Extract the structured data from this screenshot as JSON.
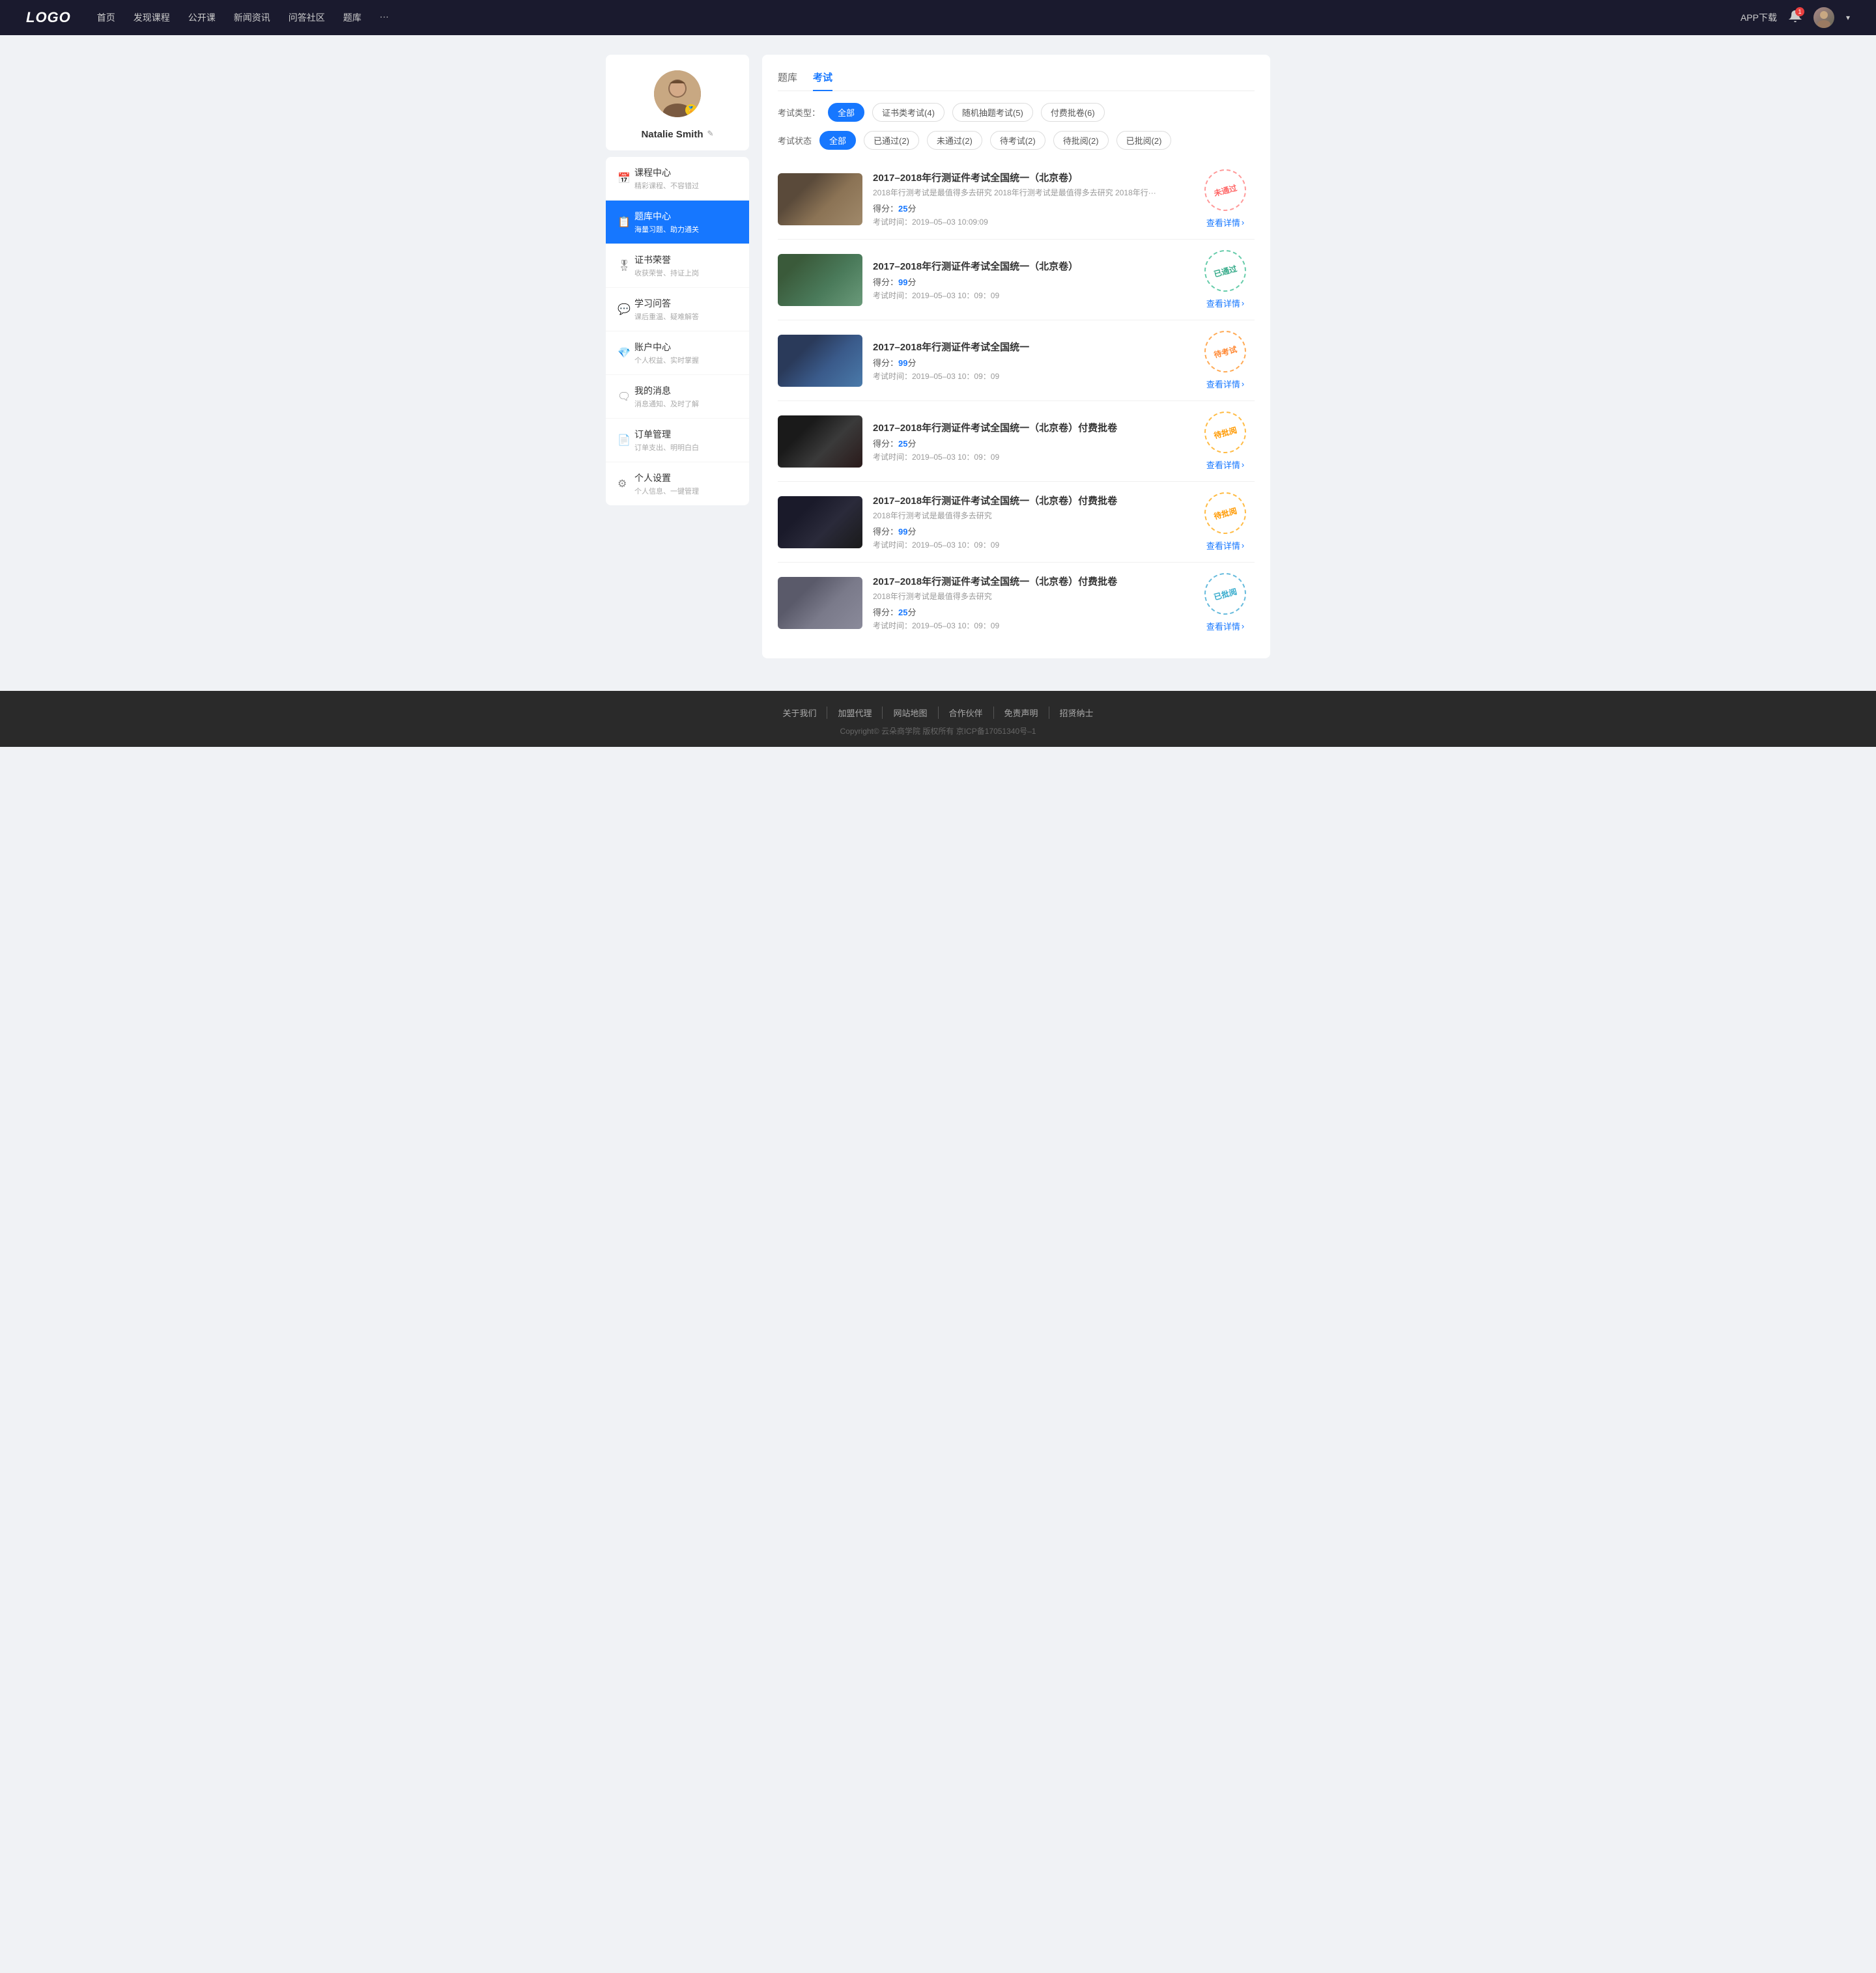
{
  "navbar": {
    "logo": "LOGO",
    "links": [
      "首页",
      "发现课程",
      "公开课",
      "新闻资讯",
      "问答社区",
      "题库",
      "···"
    ],
    "app_download": "APP下载",
    "more_icon": "···"
  },
  "sidebar": {
    "profile": {
      "name": "Natalie Smith",
      "edit_icon": "✎",
      "badge_icon": "🏅"
    },
    "items": [
      {
        "id": "course",
        "icon": "📅",
        "label": "课程中心",
        "sub": "精彩课程、不容错过"
      },
      {
        "id": "question",
        "icon": "📋",
        "label": "题库中心",
        "sub": "海量习题、助力通关"
      },
      {
        "id": "cert",
        "icon": "🎖",
        "label": "证书荣誉",
        "sub": "收获荣誉、持证上岗"
      },
      {
        "id": "qa",
        "icon": "💬",
        "label": "学习问答",
        "sub": "课后重温、疑难解答"
      },
      {
        "id": "account",
        "icon": "💎",
        "label": "账户中心",
        "sub": "个人权益、实时掌握"
      },
      {
        "id": "message",
        "icon": "🗨",
        "label": "我的消息",
        "sub": "消息通知、及时了解"
      },
      {
        "id": "order",
        "icon": "📄",
        "label": "订单管理",
        "sub": "订单支出、明明白白"
      },
      {
        "id": "settings",
        "icon": "⚙",
        "label": "个人设置",
        "sub": "个人信息、一键管理"
      }
    ]
  },
  "content": {
    "tabs": [
      "题库",
      "考试"
    ],
    "active_tab": "考试",
    "type_filter": {
      "label": "考试类型：",
      "options": [
        "全部",
        "证书类考试(4)",
        "随机抽题考试(5)",
        "付费批卷(6)"
      ],
      "active": "全部"
    },
    "status_filter": {
      "label": "考试状态",
      "options": [
        "全部",
        "已通过(2)",
        "未通过(2)",
        "待考试(2)",
        "待批阅(2)",
        "已批阅(2)"
      ],
      "active": "全部"
    },
    "exams": [
      {
        "id": 1,
        "thumb_class": "thumb-1",
        "title": "2017–2018年行测证件考试全国统一（北京卷）",
        "desc": "2018年行测考试是最值得多去研究 2018年行测考试是最值得多去研究 2018年行···",
        "score_label": "得分：",
        "score": "25",
        "score_unit": "分",
        "time_label": "考试时间：",
        "time": "2019–05–03  10:09:09",
        "stamp_text": "未通过",
        "stamp_class": "stamp-fail",
        "link": "查看详情"
      },
      {
        "id": 2,
        "thumb_class": "thumb-2",
        "title": "2017–2018年行测证件考试全国统一（北京卷）",
        "desc": "",
        "score_label": "得分：",
        "score": "99",
        "score_unit": "分",
        "time_label": "考试时间：",
        "time": "2019–05–03  10：09：09",
        "stamp_text": "已通过",
        "stamp_class": "stamp-pass",
        "link": "查看详情"
      },
      {
        "id": 3,
        "thumb_class": "thumb-3",
        "title": "2017–2018年行测证件考试全国统一",
        "desc": "",
        "score_label": "得分：",
        "score": "99",
        "score_unit": "分",
        "time_label": "考试时间：",
        "time": "2019–05–03  10：09：09",
        "stamp_text": "待考试",
        "stamp_class": "stamp-pending",
        "link": "查看详情"
      },
      {
        "id": 4,
        "thumb_class": "thumb-4",
        "title": "2017–2018年行测证件考试全国统一（北京卷）付费批卷",
        "desc": "",
        "score_label": "得分：",
        "score": "25",
        "score_unit": "分",
        "time_label": "考试时间：",
        "time": "2019–05–03  10：09：09",
        "stamp_text": "待批阅",
        "stamp_class": "stamp-review",
        "link": "查看详情"
      },
      {
        "id": 5,
        "thumb_class": "thumb-5",
        "title": "2017–2018年行测证件考试全国统一（北京卷）付费批卷",
        "desc": "2018年行测考试是最值得多去研究",
        "score_label": "得分：",
        "score": "99",
        "score_unit": "分",
        "time_label": "考试时间：",
        "time": "2019–05–03  10：09：09",
        "stamp_text": "待批阅",
        "stamp_class": "stamp-review",
        "link": "查看详情"
      },
      {
        "id": 6,
        "thumb_class": "thumb-6",
        "title": "2017–2018年行测证件考试全国统一（北京卷）付费批卷",
        "desc": "2018年行测考试是最值得多去研究",
        "score_label": "得分：",
        "score": "25",
        "score_unit": "分",
        "time_label": "考试时间：",
        "time": "2019–05–03  10：09：09",
        "stamp_text": "已批阅",
        "stamp_class": "stamp-reviewed",
        "link": "查看详情"
      }
    ]
  },
  "footer": {
    "links": [
      "关于我们",
      "加盟代理",
      "网站地图",
      "合作伙伴",
      "免责声明",
      "招贤纳士"
    ],
    "copyright": "Copyright© 云朵商学院  版权所有    京ICP备17051340号–1"
  }
}
